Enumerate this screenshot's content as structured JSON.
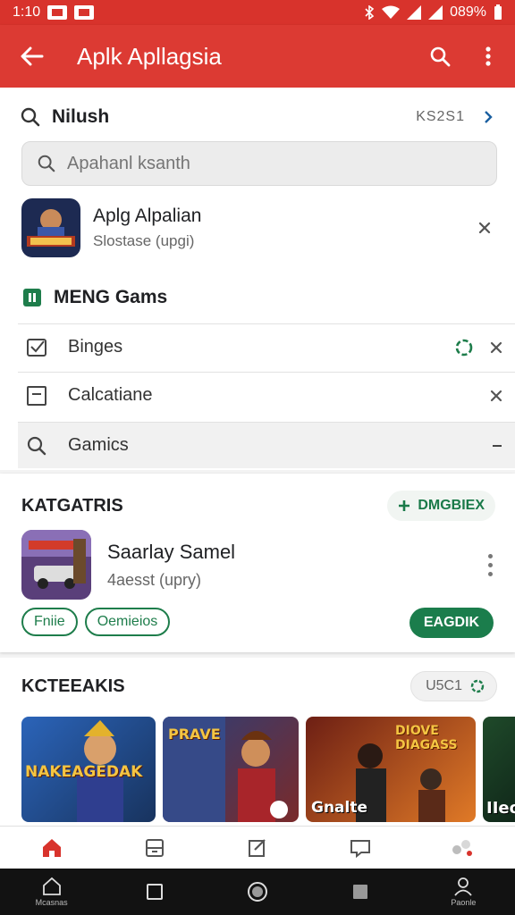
{
  "status_bar": {
    "time": "1:10",
    "battery": "089%"
  },
  "app_bar": {
    "title": "Aplk Apllagsia"
  },
  "search_header": {
    "label": "Nilush",
    "meta": "KS2S1"
  },
  "search_box": {
    "placeholder": "Apahanl ksanth"
  },
  "recent_item": {
    "name": "Aplg Alpalian",
    "subtitle": "Slostase (upgi)"
  },
  "menu_section": {
    "label": "MENG Gams"
  },
  "menu_items": [
    {
      "label": "Binges",
      "icon": "check-square-icon"
    },
    {
      "label": "Calcatiane",
      "icon": "minus-square-icon"
    },
    {
      "label": "Gamics",
      "icon": "search-icon"
    }
  ],
  "categories": {
    "title": "KATGATRIS",
    "pill_label": "DMGBIEX",
    "game": {
      "name": "Saarlay Samel",
      "subtitle": "4aesst (upry)"
    },
    "chips": [
      "Fniie",
      "Oemieios"
    ],
    "install_label": "EAGDIK"
  },
  "featured": {
    "title": "KCTEEAKIS",
    "pill_label": "U5C1",
    "banners": [
      "NAKEAGEDAK",
      "PRAVE",
      "DIOVE DIAGASS",
      "Gnalte",
      "IIeo"
    ]
  },
  "system_nav": {
    "home_label": "Mcasnas",
    "profile_label": "Paonle"
  },
  "colors": {
    "brand_red": "#dc3a33",
    "accent_green": "#1b7d4c"
  }
}
